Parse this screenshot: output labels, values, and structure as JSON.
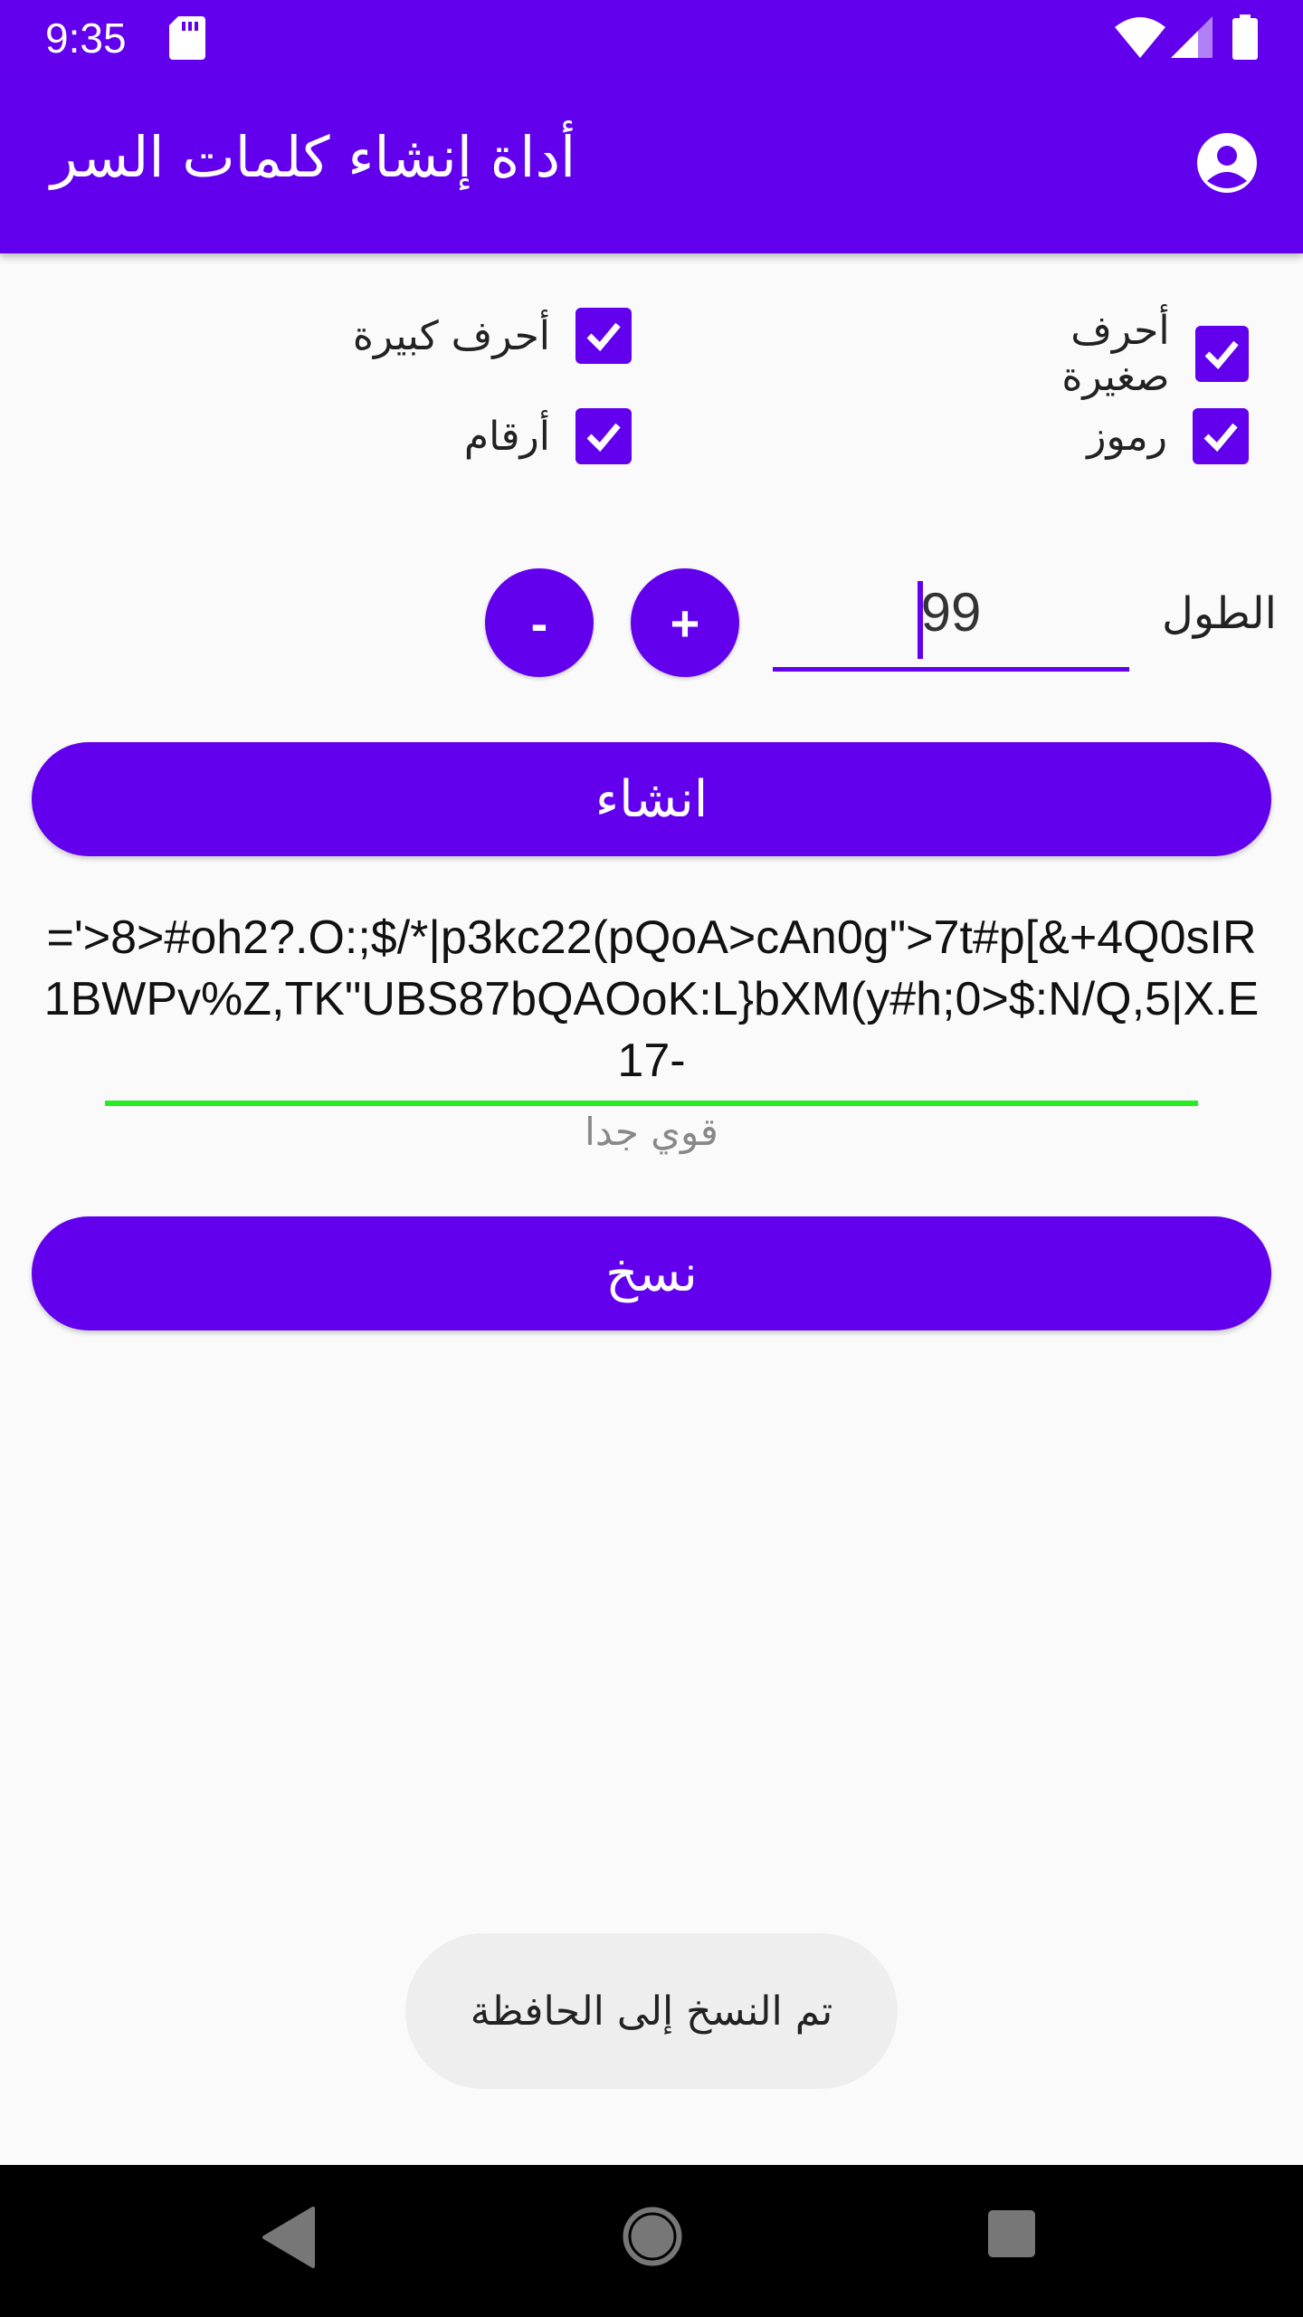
{
  "status_bar": {
    "time": "9:35",
    "icons": [
      "sd-card-icon",
      "wifi-icon",
      "signal-icon",
      "battery-icon"
    ]
  },
  "app_bar": {
    "title": "أداة إنشاء كلمات السر",
    "account_icon": "account-circle-icon"
  },
  "options": {
    "lowercase": {
      "label": "أحرف صغيرة",
      "checked": true
    },
    "uppercase": {
      "label": "أحرف كبيرة",
      "checked": true
    },
    "symbols": {
      "label": "رموز",
      "checked": true
    },
    "numbers": {
      "label": "أرقام",
      "checked": true
    }
  },
  "length": {
    "label": "الطول",
    "value": "99",
    "increment_label": "+",
    "decrement_label": "-"
  },
  "generate_button": "انشاء",
  "password": "='>8>#oh2?.O:;$/*|p3kc22(pQoA>cAn0g\">7t#p[&+4Q0sIR1BWPv%Z,TK\"UBS87bQAOoK:L}bXM(y#h;0>$:N/Q,5|X.E17-",
  "strength": {
    "label": "قوي جدا",
    "color": "#22EE22"
  },
  "copy_button": "نسخ",
  "toast": "تم النسخ إلى الحافظة",
  "colors": {
    "primary": "#6200EE",
    "background": "#FAFAFA"
  }
}
